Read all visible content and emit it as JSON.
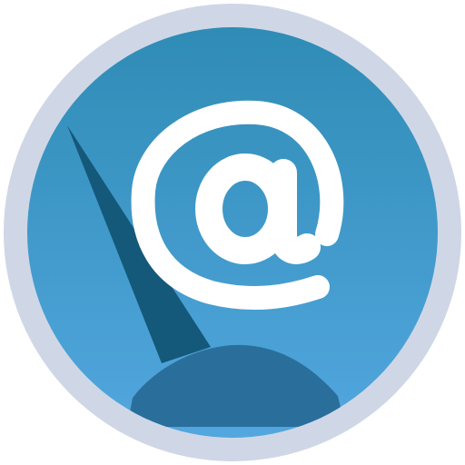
{
  "icon": {
    "name": "email-speedometer-app-icon",
    "glyph": "@",
    "colors": {
      "outer_ring": "#cfd7e6",
      "disc_top": "#2f8cb5",
      "disc_bottom": "#52a7df",
      "needle": "#14587a",
      "gauge_base": "#2a6f9c",
      "glyph": "#ffffff"
    }
  }
}
